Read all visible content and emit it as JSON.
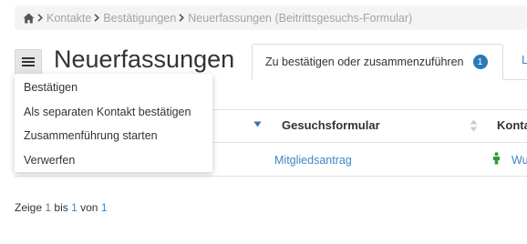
{
  "breadcrumb": {
    "items": [
      "Kontakte",
      "Bestätigungen",
      "Neuerfassungen (Beitrittsgesuchs-Formular)"
    ]
  },
  "header": {
    "title": "Neuerfassungen"
  },
  "tabs": {
    "active_label": "Zu bestätigen oder zusammenzuführen",
    "active_count": "1",
    "next_label_partial": "L"
  },
  "dropdown": {
    "items": [
      "Bestätigen",
      "Als separaten Kontakt bestätigen",
      "Zusammenführung starten",
      "Verwerfen"
    ]
  },
  "table": {
    "columns": [
      "Gesuchsformular",
      "Konta"
    ],
    "rows": [
      {
        "form": "Mitgliedsantrag",
        "contact": "Wu"
      }
    ]
  },
  "pager": {
    "prefix": "Zeige",
    "from": "1",
    "to_word": "bis",
    "to": "1",
    "of_word": "von",
    "total": "1"
  },
  "colors": {
    "link": "#3a87c8",
    "badge": "#2a7ab8",
    "sort_active": "#3a6fb5",
    "person_icon": "#2e9c3a"
  },
  "icons": [
    "home-icon",
    "chevron-right-icon",
    "hamburger-icon",
    "sort-desc-icon",
    "sort-icon",
    "person-icon"
  ]
}
